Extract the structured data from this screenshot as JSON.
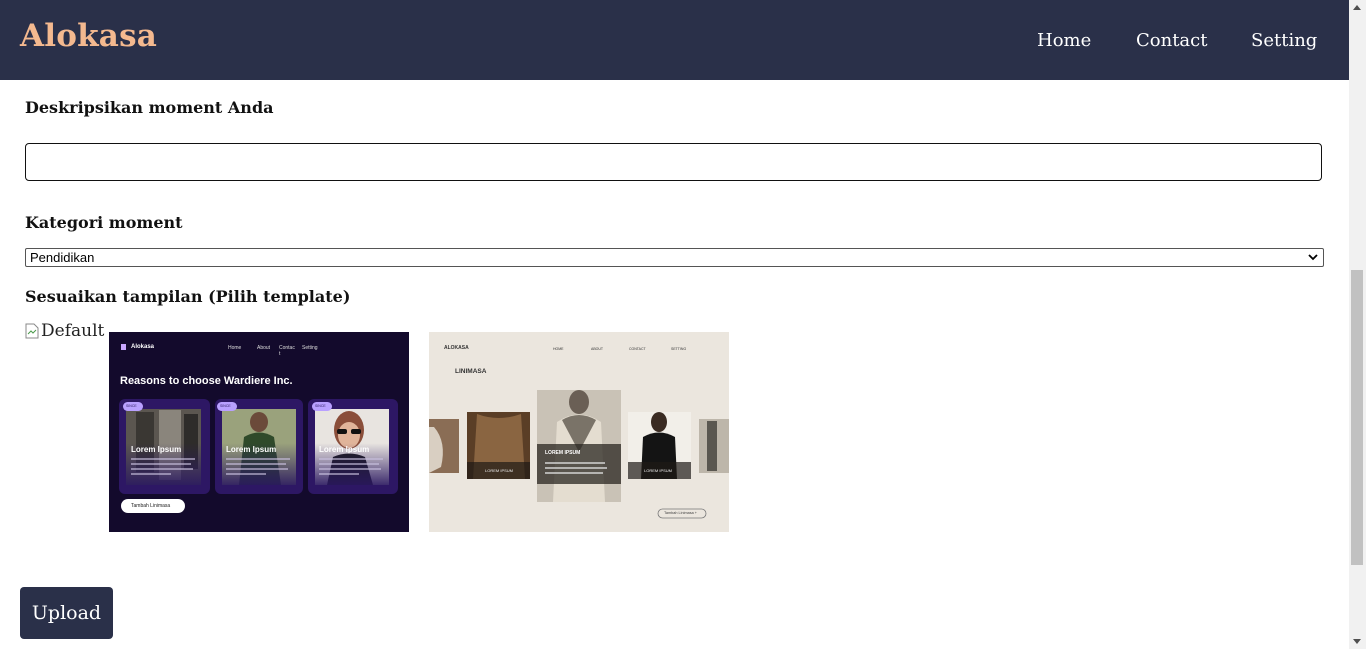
{
  "header": {
    "brand": "Alokasa",
    "nav": [
      {
        "label": "Home"
      },
      {
        "label": "Contact"
      },
      {
        "label": "Setting"
      }
    ]
  },
  "form": {
    "description_label": "Deskripsikan moment Anda",
    "description_value": "",
    "category_label": "Kategori moment",
    "category_selected": "Pendidikan",
    "template_label": "Sesuaikan tampilan (Pilih template)",
    "default_template_alt": "Default",
    "upload_label": "Upload"
  },
  "template1": {
    "brand": "Alokasa",
    "nav": [
      "Home",
      "About",
      "Contac t",
      "Setting"
    ],
    "heading": "Reasons to choose Wardiere Inc.",
    "cards": [
      {
        "tag": "SINCE",
        "title": "Lorem Ipsum"
      },
      {
        "tag": "SINCE",
        "title": "Lorem Ipsum"
      },
      {
        "tag": "SINCE",
        "title": "Lorem Ipsum"
      }
    ],
    "button": "Tambah Linimasa"
  },
  "template2": {
    "brand": "ALOKASA",
    "nav": [
      "HOME",
      "ABOUT",
      "CONTACT",
      "SETTING"
    ],
    "heading": "LINIMASA",
    "card_labels": [
      "LOREM IPSUM",
      "LOREM IPSUM",
      "LOREM IPSUM"
    ],
    "button": "Tambah Linimasa +"
  },
  "colors": {
    "navbar": "#2a3049",
    "brand": "#f4b98f",
    "template1_bg": "#130a2c",
    "template2_bg": "#ebe6de"
  }
}
